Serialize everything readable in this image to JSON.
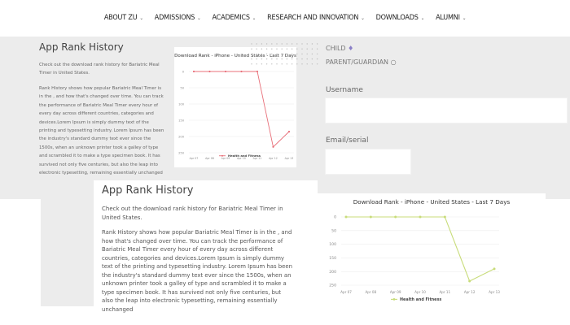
{
  "nav": {
    "items": [
      {
        "label": "ABOUT ZU"
      },
      {
        "label": "ADMISSIONS"
      },
      {
        "label": "ACADEMICS"
      },
      {
        "label": "RESEARCH AND INNOVATION"
      },
      {
        "label": "DOWNLOADS"
      },
      {
        "label": "ALUMNI"
      }
    ]
  },
  "top_panel": {
    "title": "App Rank History",
    "intro": "Check out the download rank history for Bariatric Meal Timer in United States.",
    "body": "Rank History shows how popular Bariatric Meal Timer is in the , and how that's changed over time. You can track the performance of Bariatric Meal Timer every hour of every day across different countries, categories and devices.Lorem Ipsum is simply dummy text of the printing and typesetting industry. Lorem Ipsum has been the industry's standard dummy text ever since the 1500s, when an unknown printer took a galley of type and scrambled it to make a type specimen book. It has survived not only five centuries, but also the leap into electronic typesetting, remaining essentially unchanged"
  },
  "side_form": {
    "child_label": "CHILD",
    "parent_label": "PARENT/GUARDIAN",
    "name_label": "Username",
    "email_label": "Email/serial"
  },
  "bottom_panel": {
    "title": "App Rank History",
    "intro": "Check out the download rank history for Bariatric Meal Timer in United States.",
    "body": "Rank History shows how popular Bariatric Meal Timer is in the , and how that's changed over time. You can track the performance of Bariatric Meal Timer every hour of every day across different countries, categories and devices.Lorem Ipsum is simply dummy text of the printing and typesetting industry. Lorem Ipsum has been the industry's standard dummy text ever since the 1500s, when an unknown printer took a galley of type and scrambled it to make a type specimen book. It has survived not only five centuries, but also the leap into electronic typesetting, remaining essentially unchanged"
  },
  "chart_data": [
    {
      "type": "line",
      "title": "Download Rank - iPhone - United States - Last 7 Days",
      "x": [
        "Apr 07",
        "Apr 08",
        "Apr 09",
        "Apr 10",
        "Apr 11",
        "Apr 12",
        "Apr 13"
      ],
      "yticks": [
        "0",
        "50",
        "100",
        "150",
        "200",
        "250"
      ],
      "ylim": [
        0,
        250
      ],
      "y_reversed": true,
      "series": [
        {
          "name": "Health and Fitness",
          "values": [
            0,
            0,
            0,
            0,
            0,
            232,
            185
          ]
        }
      ],
      "color": "#e8707a",
      "legend": "bottom"
    },
    {
      "type": "line",
      "title": "Download Rank - iPhone - United States - Last 7 Days",
      "x": [
        "Apr 07",
        "Apr 08",
        "Apr 09",
        "Apr 10",
        "Apr 11",
        "Apr 12",
        "Apr 13"
      ],
      "yticks": [
        "0",
        "50",
        "100",
        "150",
        "200",
        "250"
      ],
      "ylim": [
        0,
        250
      ],
      "y_reversed": true,
      "series": [
        {
          "name": "Health and Fitness",
          "values": [
            0,
            0,
            0,
            0,
            0,
            235,
            190
          ]
        }
      ],
      "color": "#c8dc7a",
      "legend": "bottom"
    }
  ]
}
